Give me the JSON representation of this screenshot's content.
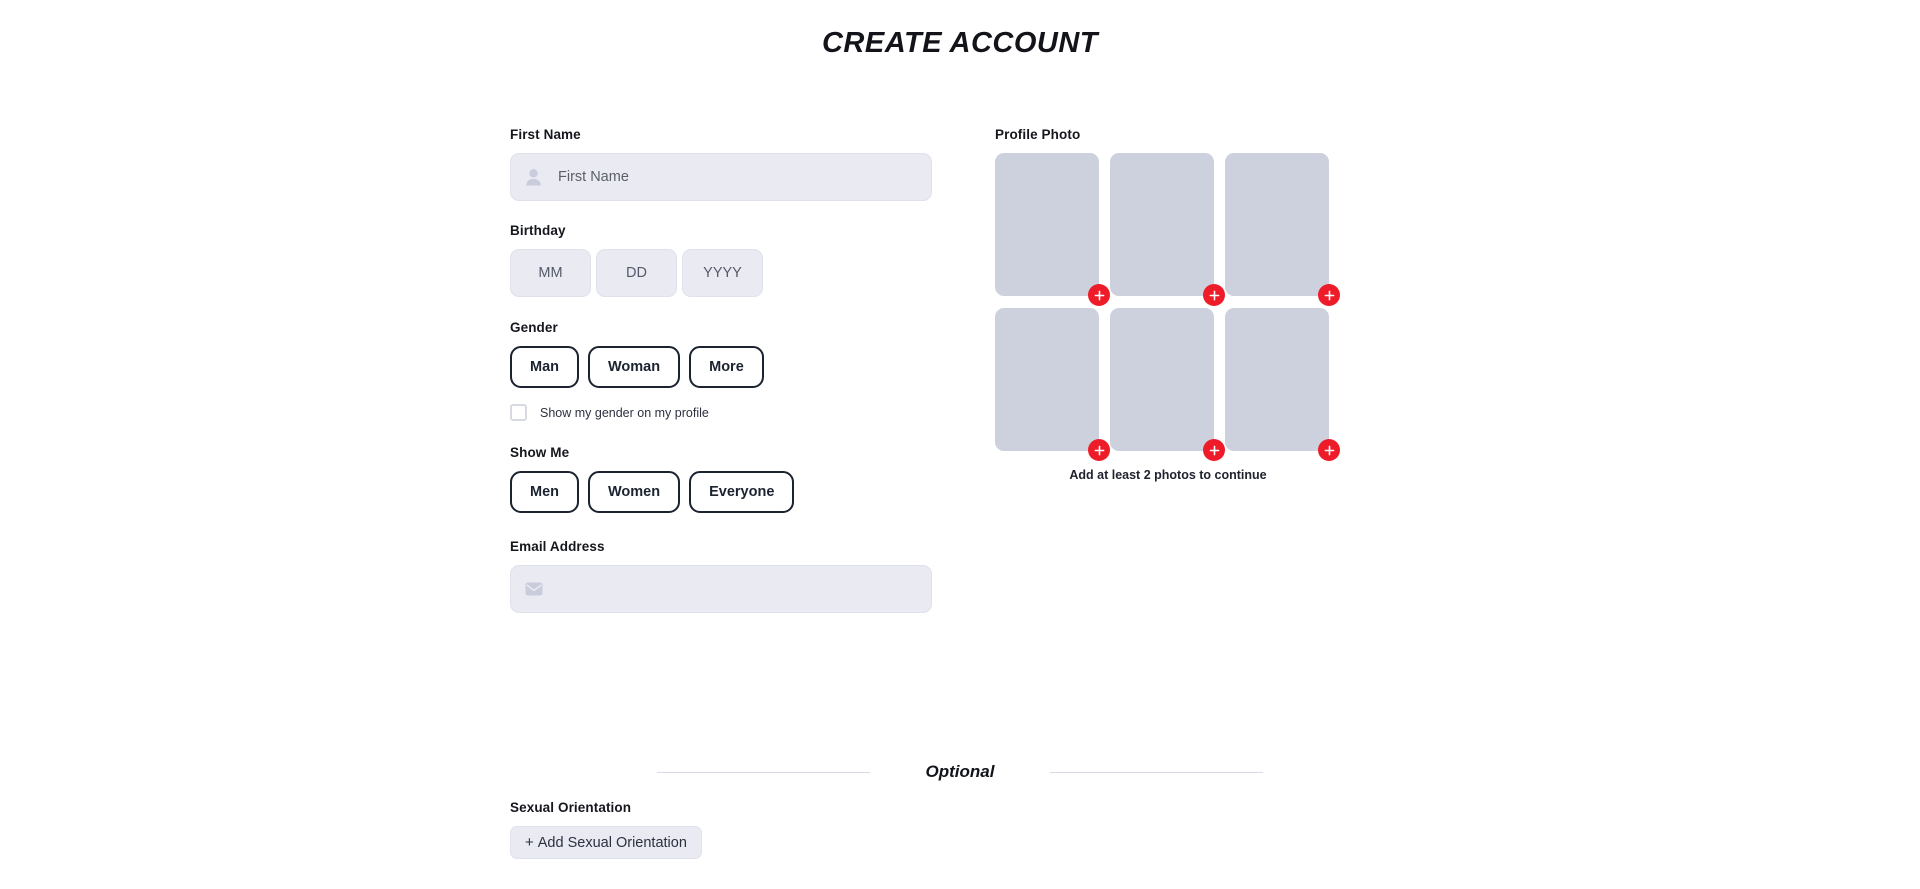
{
  "page": {
    "title": "CREATE ACCOUNT"
  },
  "colors": {
    "accent_red": "#ee1c29",
    "input_bg": "#e9eaf2",
    "photo_placeholder": "#ccd1dd",
    "text_dark": "#1b2330",
    "divider": "#d9dae4"
  },
  "form": {
    "first_name": {
      "label": "First Name",
      "placeholder": "First Name",
      "value": "",
      "icon": "person-icon"
    },
    "birthday": {
      "label": "Birthday",
      "fields": [
        {
          "name": "month",
          "placeholder": "MM",
          "value": ""
        },
        {
          "name": "day",
          "placeholder": "DD",
          "value": ""
        },
        {
          "name": "year",
          "placeholder": "YYYY",
          "value": ""
        }
      ]
    },
    "gender": {
      "label": "Gender",
      "options": [
        "Man",
        "Woman",
        "More"
      ],
      "selected": null,
      "checkbox": {
        "label": "Show my gender on my profile",
        "checked": false
      }
    },
    "show_me": {
      "label": "Show Me",
      "options": [
        "Men",
        "Women",
        "Everyone"
      ],
      "selected": null
    },
    "email": {
      "label": "Email Address",
      "placeholder": "",
      "value": "",
      "icon": "envelope-icon"
    }
  },
  "profile_photo": {
    "label": "Profile Photo",
    "slots": [
      {
        "index": 1,
        "filled": false,
        "add_icon": "plus-icon"
      },
      {
        "index": 2,
        "filled": false,
        "add_icon": "plus-icon"
      },
      {
        "index": 3,
        "filled": false,
        "add_icon": "plus-icon"
      },
      {
        "index": 4,
        "filled": false,
        "add_icon": "plus-icon"
      },
      {
        "index": 5,
        "filled": false,
        "add_icon": "plus-icon"
      },
      {
        "index": 6,
        "filled": false,
        "add_icon": "plus-icon"
      }
    ],
    "hint": "Add at least 2 photos to continue"
  },
  "optional_section": {
    "divider_label": "Optional",
    "sexual_orientation": {
      "label": "Sexual Orientation",
      "add_button": "Add Sexual Orientation",
      "add_button_prefix": "+"
    }
  }
}
